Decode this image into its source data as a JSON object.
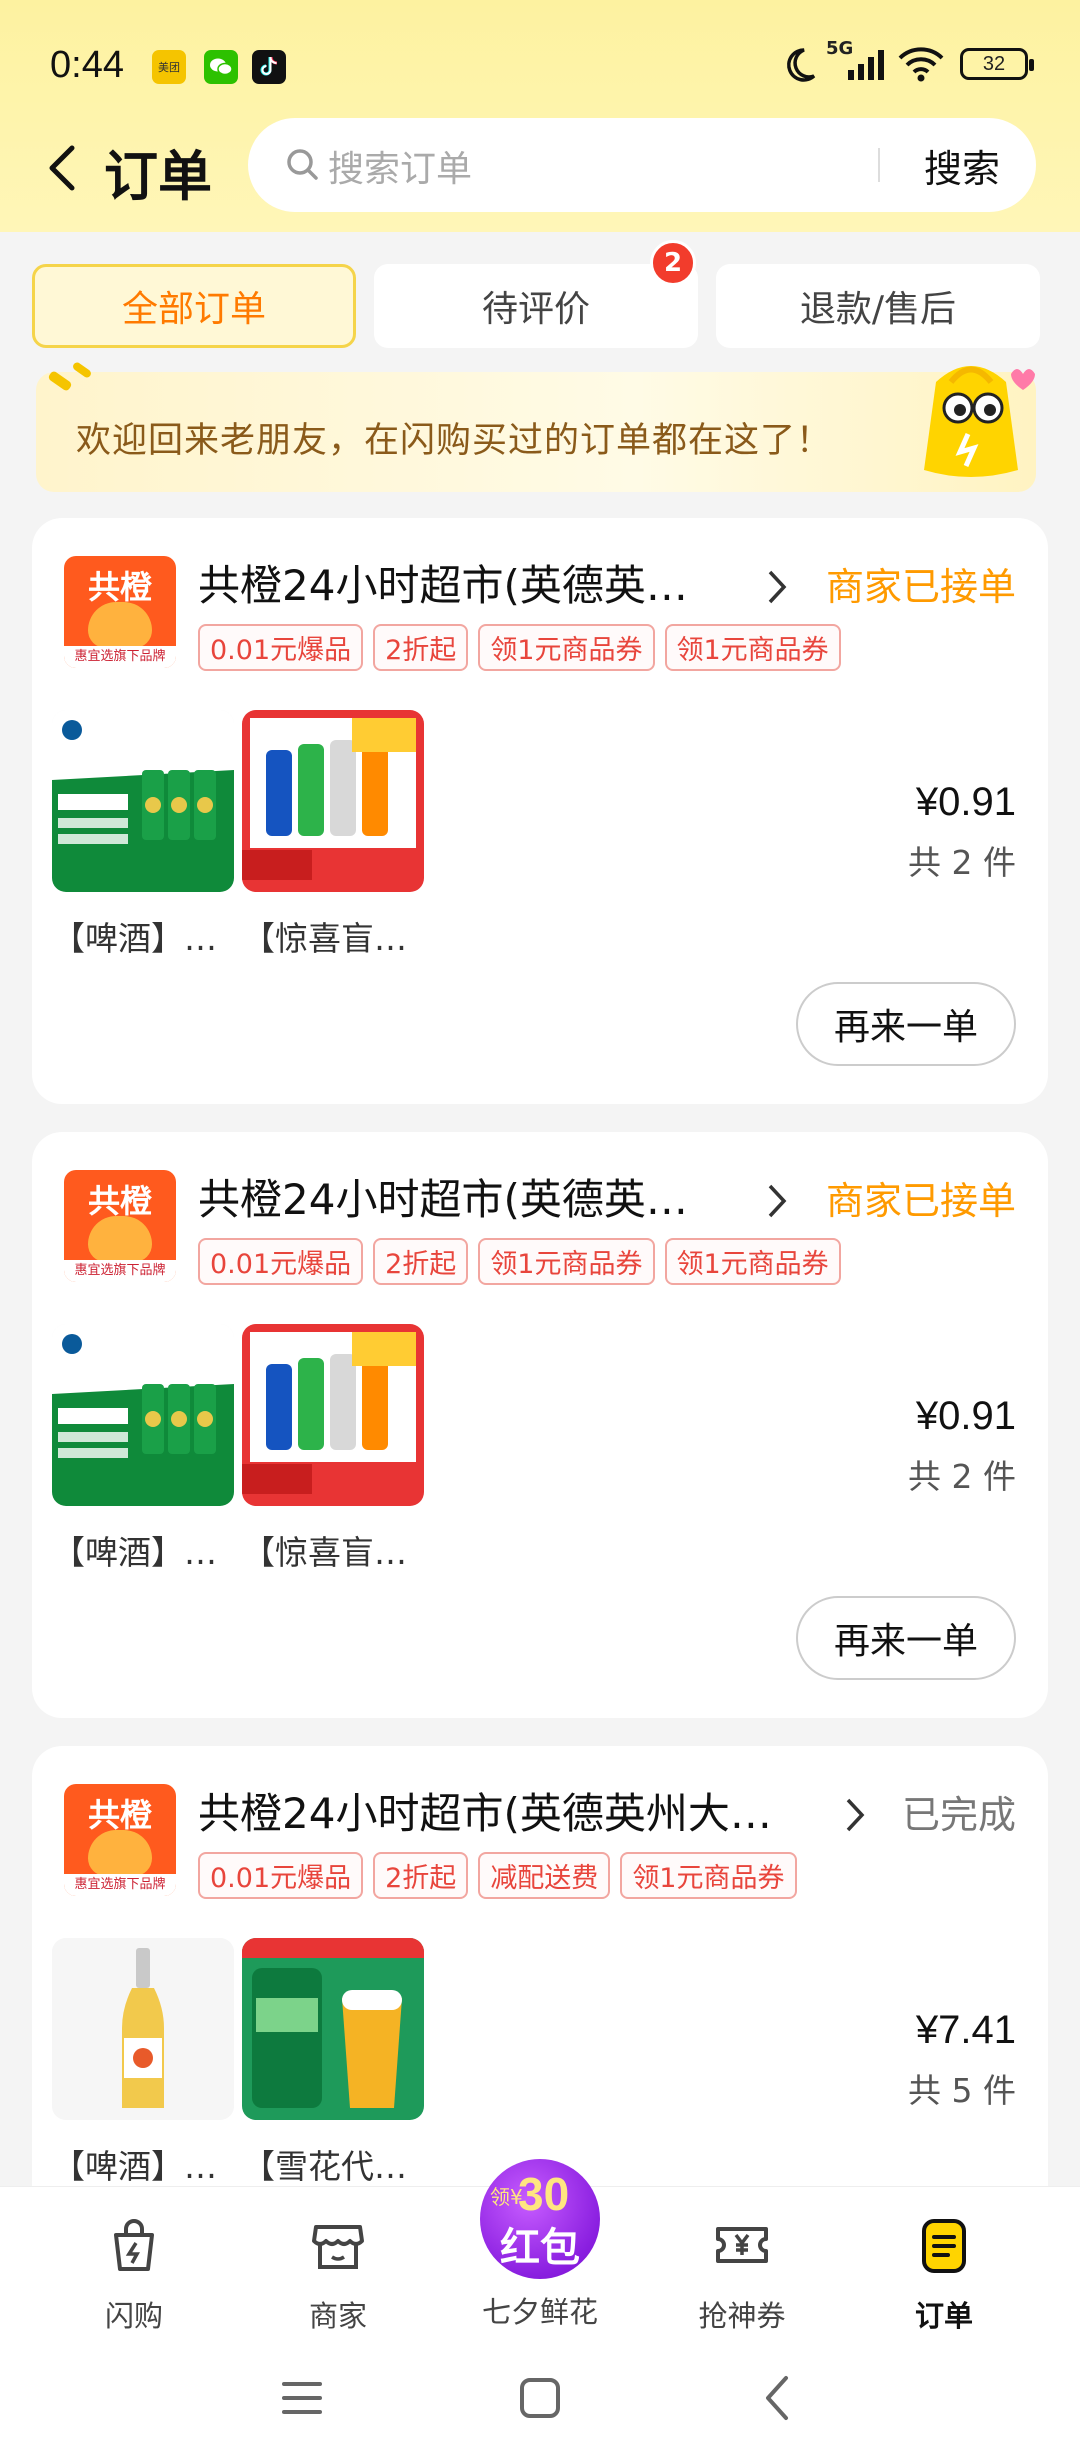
{
  "status_bar": {
    "time": "0:44",
    "network": "5G",
    "battery": "32",
    "apps": [
      "美团",
      "微信",
      "抖音"
    ]
  },
  "nav": {
    "title": "订单",
    "search_placeholder": "搜索订单",
    "search_button": "搜索"
  },
  "tabs": [
    {
      "label": "全部订单",
      "active": true
    },
    {
      "label": "待评价",
      "badge": "2"
    },
    {
      "label": "退款/售后"
    }
  ],
  "welcome": "欢迎回来老朋友，在闪购买过的订单都在这了！",
  "orders": [
    {
      "shop": "共橙24小时超市(英德英…",
      "status": "商家已接单",
      "tags": [
        "0.01元爆品",
        "2折起",
        "领1元商品券",
        "领1元商品券"
      ],
      "products": [
        "【啤酒】…",
        "【惊喜盲…"
      ],
      "price": "¥0.91",
      "count": "共 2 件",
      "action": "再来一单"
    },
    {
      "shop": "共橙24小时超市(英德英…",
      "status": "商家已接单",
      "tags": [
        "0.01元爆品",
        "2折起",
        "领1元商品券",
        "领1元商品券"
      ],
      "products": [
        "【啤酒】…",
        "【惊喜盲…"
      ],
      "price": "¥0.91",
      "count": "共 2 件",
      "action": "再来一单"
    },
    {
      "shop": "共橙24小时超市(英德英州大…",
      "status": "已完成",
      "tags": [
        "0.01元爆品",
        "2折起",
        "减配送费",
        "领1元商品券"
      ],
      "products": [
        "【啤酒】…",
        "【雪花代…"
      ],
      "price": "¥7.41",
      "count": "共 5 件"
    }
  ],
  "logo": {
    "top": "共橙",
    "bottom": "惠宜选旗下品牌"
  },
  "tabbar": [
    {
      "label": "闪购",
      "icon": "bag-icon"
    },
    {
      "label": "商家",
      "icon": "store-icon"
    },
    {
      "label": "七夕鲜花",
      "icon": "red-packet-icon"
    },
    {
      "label": "抢神券",
      "icon": "coupon-icon"
    },
    {
      "label": "订单",
      "icon": "order-icon",
      "active": true
    }
  ],
  "promo": {
    "prefix": "领¥",
    "amount": "30",
    "text": "红包"
  },
  "colors": {
    "accent": "#ff9a00",
    "header_bg": "#fff6b8",
    "tag_red": "#e8453c",
    "promo_purple": "#8a1fe0"
  }
}
